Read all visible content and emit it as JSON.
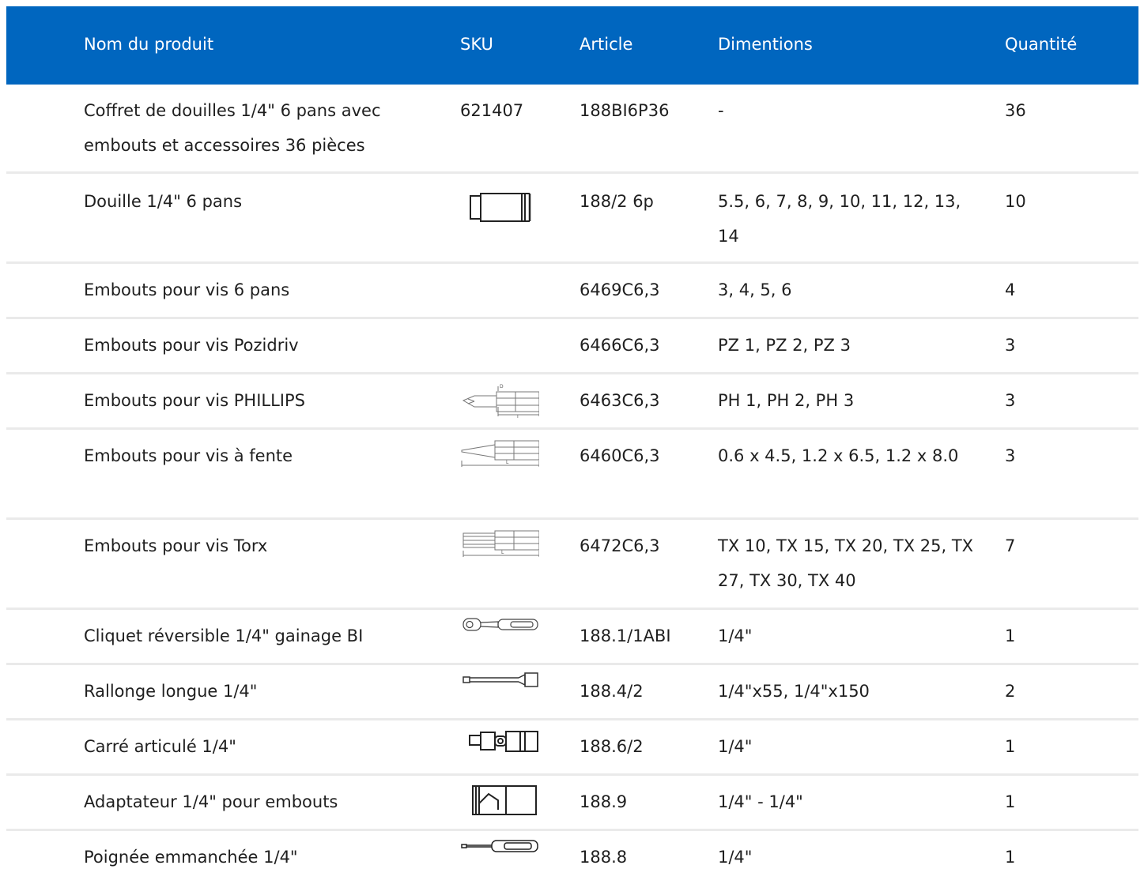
{
  "colors": {
    "header_bg": "#0066bf",
    "header_text": "#ffffff",
    "row_divider": "#eaeaea",
    "text": "#1f1f1f"
  },
  "table": {
    "headers": {
      "name": "Nom du produit",
      "sku": "SKU",
      "article": "Article",
      "dimensions": "Dimentions",
      "quantity": "Quantité"
    },
    "rows": [
      {
        "name": "Coffret de douilles 1/4\" 6 pans avec embouts et accessoires 36 pièces",
        "sku": "621407",
        "article": "188BI6P36",
        "dimensions": "-",
        "quantity": "36"
      },
      {
        "name": "Douille 1/4\" 6 pans",
        "sku_icon": "socket-icon",
        "article": "188/2 6p",
        "dimensions": "5.5, 6, 7, 8, 9, 10, 11, 12, 13, 14",
        "quantity": "10"
      },
      {
        "name": "Embouts pour vis 6 pans",
        "article": "6469C6,3",
        "dimensions": "3, 4, 5, 6",
        "quantity": "4"
      },
      {
        "name": "Embouts pour vis Pozidriv",
        "article": "6466C6,3",
        "dimensions": "PZ 1, PZ 2, PZ 3",
        "quantity": "3"
      },
      {
        "name": "Embouts pour vis PHILLIPS",
        "sku_icon": "phillips-bit-icon",
        "article": "6463C6,3",
        "dimensions": "PH 1, PH 2, PH 3",
        "quantity": "3"
      },
      {
        "name": "Embouts pour vis à fente",
        "sku_icon": "slotted-bit-icon",
        "article": "6460C6,3",
        "dimensions": "0.6 x 4.5, 1.2 x 6.5, 1.2 x 8.0",
        "quantity": "3"
      },
      {
        "name": "Embouts pour vis Torx",
        "sku_icon": "torx-bit-icon",
        "article": "6472C6,3",
        "dimensions": "TX 10, TX 15, TX 20, TX 25, TX 27, TX 30, TX 40",
        "quantity": "7"
      },
      {
        "name": "Cliquet réversible 1/4\" gainage BI",
        "sku_icon": "ratchet-icon",
        "article": "188.1/1ABI",
        "dimensions": "1/4\"",
        "quantity": "1"
      },
      {
        "name": "Rallonge longue 1/4\"",
        "sku_icon": "extension-bar-icon",
        "article": "188.4/2",
        "dimensions": "1/4\"x55, 1/4\"x150",
        "quantity": "2"
      },
      {
        "name": "Carré articulé 1/4\"",
        "sku_icon": "universal-joint-icon",
        "article": "188.6/2",
        "dimensions": "1/4\"",
        "quantity": "1"
      },
      {
        "name": "Adaptateur 1/4\" pour embouts",
        "sku_icon": "bit-adapter-icon",
        "article": "188.9",
        "dimensions": "1/4\" - 1/4\"",
        "quantity": "1"
      },
      {
        "name": "Poignée emmanchée 1/4\"",
        "sku_icon": "spinner-handle-icon",
        "article": "188.8",
        "dimensions": "1/4\"",
        "quantity": "1"
      }
    ]
  }
}
